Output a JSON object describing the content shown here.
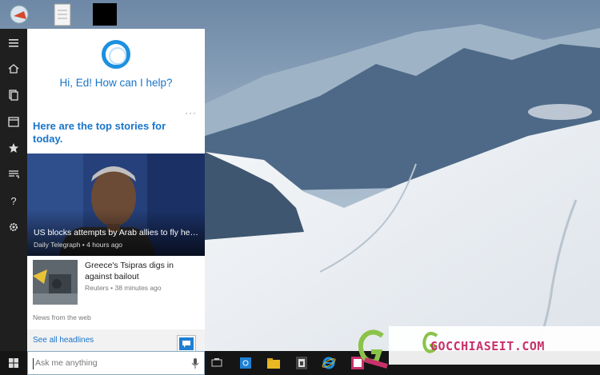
{
  "colors": {
    "accent": "#1975c9",
    "cortana": "#1e90e0",
    "rail": "#1f1f1f",
    "taskbar": "#151515",
    "watermark": "#c8326a"
  },
  "desktop": {
    "icons": [
      "recycle-bin-icon",
      "document-icon",
      "black-window-icon"
    ]
  },
  "rail": {
    "items": [
      "hamburger-menu-icon",
      "home-icon",
      "notebook-icon",
      "calendar-icon",
      "star-icon",
      "feedback-icon",
      "help-icon",
      "settings-gear-icon"
    ]
  },
  "cortana": {
    "greeting": "Hi, Ed! How can I help?",
    "more": "···",
    "top_stories_title": "Here are the top stories for today.",
    "hero": {
      "title": "US blocks attempts by Arab allies to fly he…",
      "source": "Daily Telegraph • 4 hours ago"
    },
    "story2": {
      "title": "Greece's Tsipras digs in against bailout",
      "source": "Reuters • 38 minutes ago"
    },
    "web_label": "News from the web",
    "see_all": "See all headlines"
  },
  "taskbar": {
    "search_placeholder": "Ask me anything",
    "icons": [
      "windows-start-icon",
      "task-view-icon",
      "store-icon",
      "file-explorer-icon",
      "calculator-icon",
      "internet-explorer-icon",
      "photos-icon"
    ]
  },
  "watermark": {
    "text": "GOCCHIASEIT.COM"
  }
}
